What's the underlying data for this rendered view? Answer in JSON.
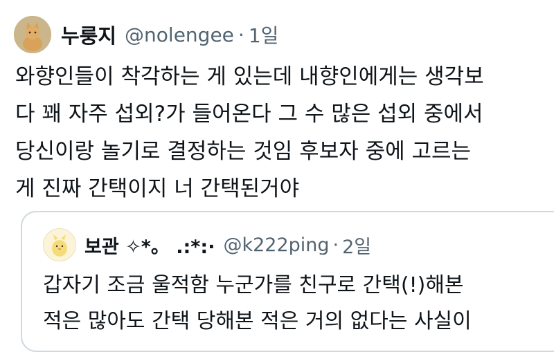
{
  "tweet": {
    "author_name": "누룽지",
    "handle": "@nolengee",
    "separator": "·",
    "time": "1일",
    "text": "와향인들이 착각하는 게 있는데 내향인에게는 생각보\n다 꽤 자주 섭외?가 들어온다 그 수 많은 섭외 중에서\n당신이랑 놀기로 결정하는 것임  후보자 중에 고르는\n게 진짜 간택이지 너 간택된거야"
  },
  "quote": {
    "author_name": "보관 ✧*。  .:*:·",
    "handle": "@k222ping",
    "separator": "·",
    "time": "2일",
    "text": "갑자기 조금 울적함 누군가를 친구로 간택(!)해본\n적은 많아도 간택 당해본 적은 거의 없다는 사실이"
  }
}
